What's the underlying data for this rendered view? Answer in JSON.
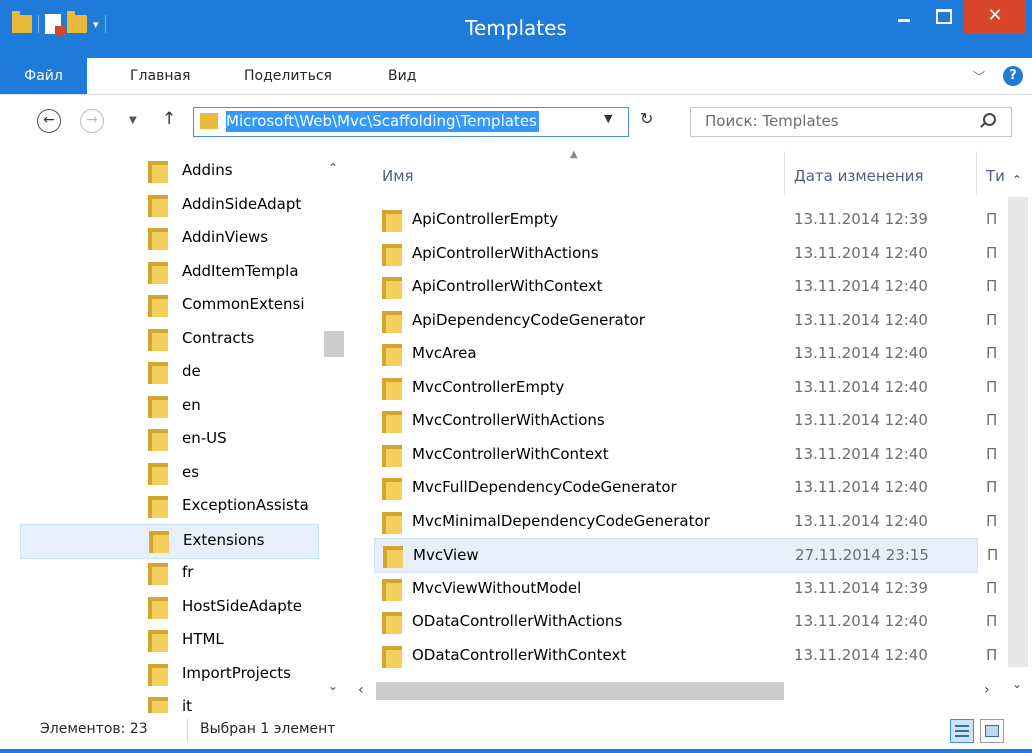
{
  "window": {
    "title": "Templates",
    "close_symbol": "✕"
  },
  "ribbon": {
    "tabs": [
      "Файл",
      "Главная",
      "Поделиться",
      "Вид"
    ],
    "help": "?"
  },
  "address": {
    "path": "Microsoft\\Web\\Mvc\\Scaffolding\\Templates",
    "search_placeholder": "Поиск: Templates"
  },
  "nav_pane": {
    "items": [
      "Addins",
      "AddinSideAdapt",
      "AddinViews",
      "AddItemTempla",
      "CommonExtensi",
      "Contracts",
      "de",
      "en",
      "en-US",
      "es",
      "ExceptionAssista",
      "Extensions",
      "fr",
      "HostSideAdapte",
      "HTML",
      "ImportProjects",
      "it"
    ],
    "selected_index": 11
  },
  "file_list": {
    "columns": {
      "name": "Имя",
      "date": "Дата изменения",
      "type": "Ти"
    },
    "rows": [
      {
        "name": "ApiControllerEmpty",
        "date": "13.11.2014 12:39",
        "type": "П"
      },
      {
        "name": "ApiControllerWithActions",
        "date": "13.11.2014 12:40",
        "type": "П"
      },
      {
        "name": "ApiControllerWithContext",
        "date": "13.11.2014 12:40",
        "type": "П"
      },
      {
        "name": "ApiDependencyCodeGenerator",
        "date": "13.11.2014 12:40",
        "type": "П"
      },
      {
        "name": "MvcArea",
        "date": "13.11.2014 12:40",
        "type": "П"
      },
      {
        "name": "MvcControllerEmpty",
        "date": "13.11.2014 12:40",
        "type": "П"
      },
      {
        "name": "MvcControllerWithActions",
        "date": "13.11.2014 12:40",
        "type": "П"
      },
      {
        "name": "MvcControllerWithContext",
        "date": "13.11.2014 12:40",
        "type": "П"
      },
      {
        "name": "MvcFullDependencyCodeGenerator",
        "date": "13.11.2014 12:40",
        "type": "П"
      },
      {
        "name": "MvcMinimalDependencyCodeGenerator",
        "date": "13.11.2014 12:40",
        "type": "П"
      },
      {
        "name": "MvcView",
        "date": "27.11.2014 23:15",
        "type": "П"
      },
      {
        "name": "MvcViewWithoutModel",
        "date": "13.11.2014 12:39",
        "type": "П"
      },
      {
        "name": "ODataControllerWithActions",
        "date": "13.11.2014 12:40",
        "type": "П"
      },
      {
        "name": "ODataControllerWithContext",
        "date": "13.11.2014 12:40",
        "type": "П"
      }
    ],
    "selected_index": 10
  },
  "status": {
    "count": "Элементов: 23",
    "selection": "Выбран 1 элемент"
  },
  "colors": {
    "accent": "#1e7bd9",
    "close": "#d9452b",
    "selection": "#e5f0fb",
    "folder": "#f3cf5e"
  }
}
